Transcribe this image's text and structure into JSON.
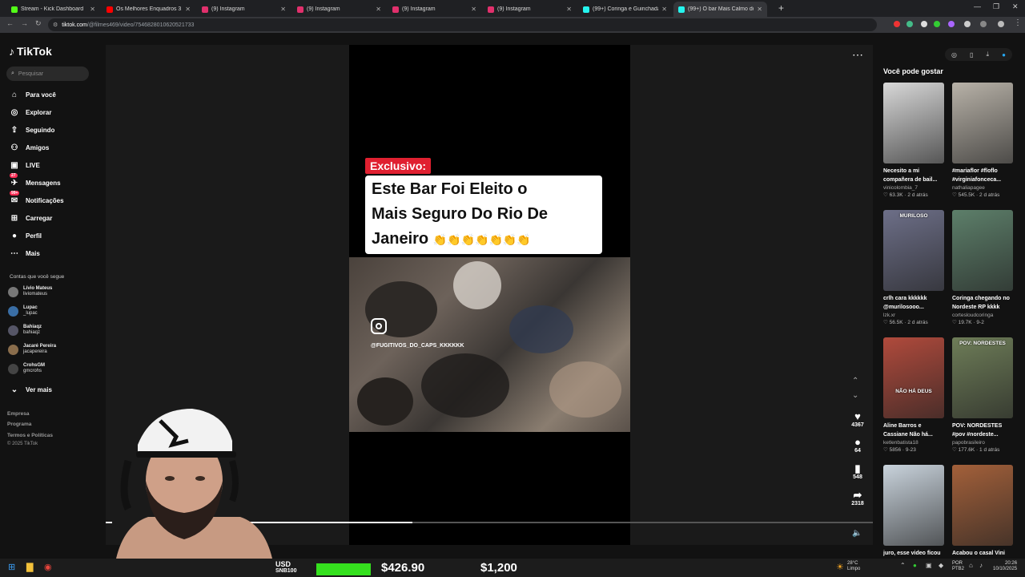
{
  "browser": {
    "tabs": [
      {
        "title": "Stream - Kick Dashboard",
        "color": "#53fc18"
      },
      {
        "title": "Os Melhores Enquadros 31 - FE",
        "color": "#ff0000"
      },
      {
        "title": "(9) Instagram",
        "color": "#e1306c"
      },
      {
        "title": "(9) Instagram",
        "color": "#e1306c"
      },
      {
        "title": "(9) Instagram",
        "color": "#e1306c"
      },
      {
        "title": "(9) Instagram",
        "color": "#e1306c"
      },
      {
        "title": "(99+) Coringa e Guinchadas Eng",
        "color": "#25f4ee"
      },
      {
        "title": "(99+) O bar Mais Calmo do",
        "color": "#25f4ee"
      }
    ],
    "new_tab": "+",
    "url_host": "tiktok.com",
    "url_path": "/@filmes469/video/7546828010620521733"
  },
  "sidebar": {
    "logo": "TikTok",
    "search_placeholder": "Pesquisar",
    "nav": [
      {
        "label": "Para você",
        "icon": "⌂"
      },
      {
        "label": "Explorar",
        "icon": "◎"
      },
      {
        "label": "Seguindo",
        "icon": "⇪"
      },
      {
        "label": "Amigos",
        "icon": "⚇"
      },
      {
        "label": "LIVE",
        "icon": "▣"
      },
      {
        "label": "Mensagens",
        "icon": "✈"
      },
      {
        "label": "Notificações",
        "icon": "✉"
      },
      {
        "label": "Carregar",
        "icon": "⊞"
      },
      {
        "label": "Perfil",
        "icon": "●"
      },
      {
        "label": "Mais",
        "icon": "⋯"
      }
    ],
    "messages_badge": "27",
    "notifications_badge": "99+",
    "following_title": "Contas que você segue",
    "following": [
      {
        "name": "Lívio Mateus",
        "handle": "liviomateus"
      },
      {
        "name": "Lupac",
        "handle": "_lupac"
      },
      {
        "name": "Bahiaqz",
        "handle": "bahiaqz"
      },
      {
        "name": "Jacaré Pereira",
        "handle": "jacapereira"
      },
      {
        "name": "CrohsGM",
        "handle": "gmcrohs"
      }
    ],
    "see_more": "Ver mais",
    "footer": [
      "Empresa",
      "Programa",
      "Termos e Políticas",
      "© 2025 TikTok"
    ]
  },
  "video": {
    "badge": "Exclusivo:",
    "headline_lines": [
      "Este Bar Foi Eleito o",
      "Mais Seguro Do Rio De",
      "Janeiro"
    ],
    "claps": "👏👏👏👏👏👏👏",
    "handle": "@FUGITIVOS_DO_CAPS_KKKKKK",
    "likes": "4367",
    "comments": "64",
    "saves": "548",
    "shares": "2318",
    "progress": 0.4
  },
  "recommendations": {
    "title": "Você pode gostar",
    "items": [
      {
        "caption": "Necesito a mi compañera de bail...",
        "author": "vinicolombia_7",
        "likes": "63.3K",
        "date": "2 d atrás",
        "bg": "#d8d8d8"
      },
      {
        "caption": "#mariaflor #floflo #virginiafonceca...",
        "author": "nathaliapagee",
        "likes": "545.5K",
        "date": "2 d atrás",
        "bg": "#b8b2a8"
      },
      {
        "caption": "crlh cara kkkkkk @murilosooo...",
        "author": "lzk.xr",
        "likes": "56.5K",
        "date": "2 d atrás",
        "bg": "#6d6f88",
        "overlay": "MURILOSO"
      },
      {
        "caption": "Coringa chegando no Nordeste RP kkkk",
        "author": "cortesloudcoringa",
        "likes": "19.7K",
        "date": "9-2",
        "bg": "#5d7f6a"
      },
      {
        "caption": "Aline Barros e Cassiane Não há...",
        "author": "ketlenbatista18",
        "likes": "5856",
        "date": "9-23",
        "bg": "#b04a3c",
        "overlay": "NÃO HÁ DEUS"
      },
      {
        "caption": "POV: NORDESTES #pov #nordeste...",
        "author": "papobrasileiro",
        "likes": "177.6K",
        "date": "1 d atrás",
        "bg": "#6e7d58",
        "overlay": "POV: NORDESTES"
      },
      {
        "caption": "juro, esse video ficou",
        "author": "",
        "likes": "",
        "date": "",
        "bg": "#c9d3dc"
      },
      {
        "caption": "Acabou o casal Vini",
        "author": "",
        "likes": "",
        "date": "",
        "bg": "#a3603a"
      }
    ]
  },
  "taskbar": {
    "usd": "USD",
    "snb": "SNB100",
    "price1": "$426.90",
    "price2": "$1,200",
    "temp": "28°C",
    "weather": "Limpo",
    "lang1": "POR",
    "lang2": "PTB2",
    "time": "20:26",
    "date": "10/10/2025"
  }
}
